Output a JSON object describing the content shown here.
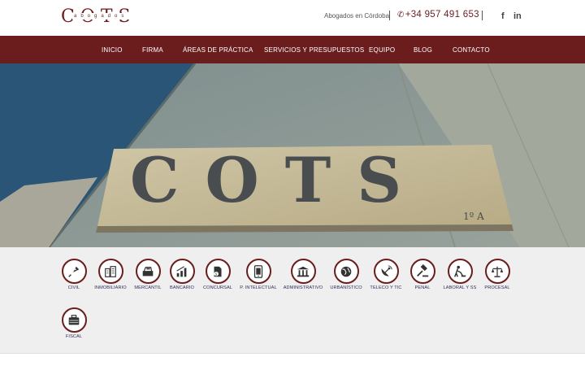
{
  "header": {
    "logo_text": "COTS",
    "logo_sub": "abogados",
    "tagline": "Abogados en Córdoba",
    "phone": "+34 957 491 653",
    "social": [
      {
        "name": "facebook",
        "glyph": "f"
      },
      {
        "name": "linkedin",
        "glyph": "in"
      }
    ]
  },
  "nav": {
    "items": [
      "INICIO",
      "FIRMA",
      "ÁREAS DE PRÁCTICA",
      "SERVICIOS Y PRESUPUESTOS",
      "EQUIPO",
      "BLOG",
      "CONTACTO"
    ]
  },
  "hero": {
    "sign_text": "COTS",
    "floor_text": "1º A"
  },
  "areas": {
    "items": [
      {
        "label": "CIVIL",
        "icon": "pen-nib-icon"
      },
      {
        "label": "INMOBILIARIO",
        "icon": "buildings-icon"
      },
      {
        "label": "MERCANTIL",
        "icon": "cash-register-icon"
      },
      {
        "label": "BANCARIO",
        "icon": "bar-chart-icon"
      },
      {
        "label": "CONCURSAL",
        "icon": "document-money-icon"
      },
      {
        "label": "P. INTELECTUAL",
        "icon": "tablet-icon"
      },
      {
        "label": "ADMINISTRATIVO",
        "icon": "government-building-icon"
      },
      {
        "label": "URBANÍSTICO",
        "icon": "globe-icon"
      },
      {
        "label": "TELECO Y TIC",
        "icon": "satellite-dish-icon"
      },
      {
        "label": "PENAL",
        "icon": "gavel-icon"
      },
      {
        "label": "LABORAL Y SS",
        "icon": "worker-icon"
      },
      {
        "label": "PROCESAL",
        "icon": "scales-icon"
      },
      {
        "label": "FISCAL",
        "icon": "briefcase-icon"
      }
    ]
  },
  "colors": {
    "brand": "#6b1d1d",
    "nav_text": "#ffffff",
    "area_label": "#2e2e5a",
    "areas_bg": "#efefef"
  }
}
